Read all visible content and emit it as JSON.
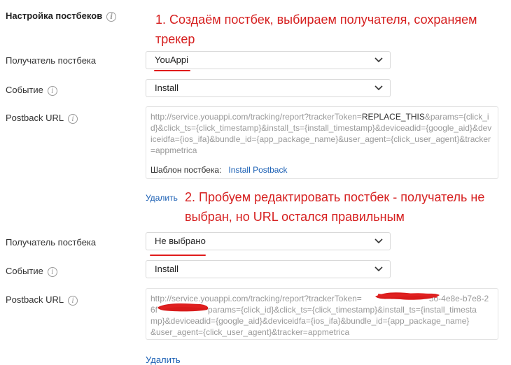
{
  "section": {
    "title": "Настройка постбеков"
  },
  "annotations": {
    "step1_line1": "1. Создаём постбек, выбираем получателя, сохраняем",
    "step1_line2": "трекер",
    "step2_line1": "2. Пробуем редактировать постбек - получатель не",
    "step2_line2": "выбран, но URL остался правильным"
  },
  "form1": {
    "recipient_label": "Получатель постбека",
    "recipient_value": "YouAppi",
    "event_label": "Событие",
    "event_value": "Install",
    "url_label": "Postback URL",
    "url_part1": "http://service.youappi.com/tracking/report?trackerToken=",
    "url_token": "REPLACE_THIS",
    "url_part2": "&params={click_id}&click_ts={click_timestamp}&install_ts={install_timestamp}&deviceadid={google_aid}&deviceidfa={ios_ifa}&bundle_id={app_package_name}&user_agent={click_user_agent}&tracker=appmetrica",
    "template_label": "Шаблон постбека:",
    "template_link": "Install Postback",
    "delete_link": "Удалить"
  },
  "form2": {
    "recipient_label": "Получатель постбека",
    "recipient_value": "Не выбрано",
    "event_label": "Событие",
    "event_value": "Install",
    "url_label": "Postback URL",
    "url_line1": "http://service.youappi.com/tracking/report?trackerToken=",
    "url_line1_tail": "50-4e8e-b7e8-2",
    "url_line2_head": "6f",
    "url_line2_tail": "params={click_id}&click_ts={click_timestamp}&install_ts={install_timesta",
    "url_line3": "mp}&deviceadid={google_aid}&deviceidfa={ios_ifa}&bundle_id={app_package_name}",
    "url_line4": "&user_agent={click_user_agent}&tracker=appmetrica",
    "delete_link": "Удалить"
  },
  "colors": {
    "annotation_red": "#d62020",
    "link_blue": "#1a5fb4"
  }
}
